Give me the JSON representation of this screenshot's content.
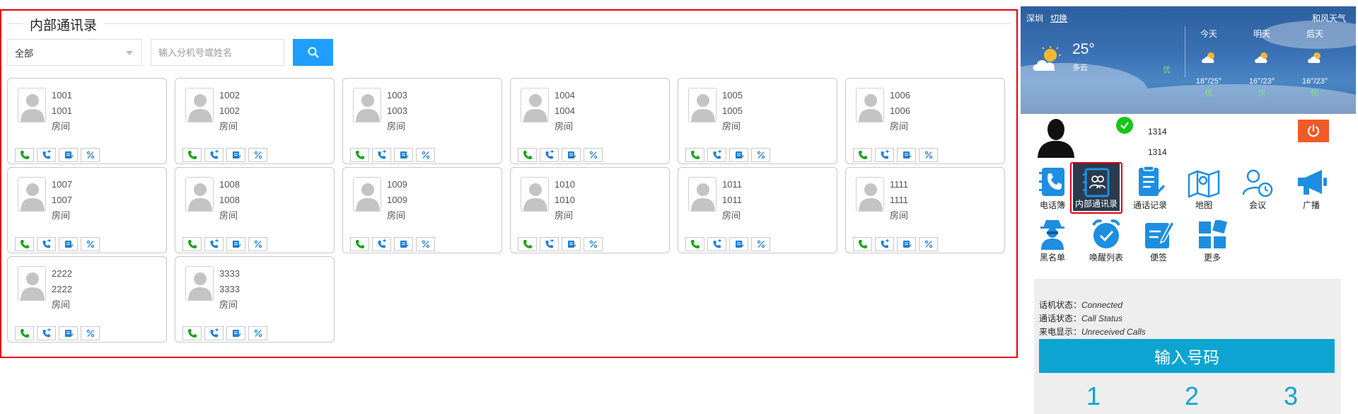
{
  "panel": {
    "title": "内部通讯录"
  },
  "filter": {
    "selected": "全部",
    "search_placeholder": "输入分机号或姓名"
  },
  "contacts": [
    {
      "number": "1001",
      "name": "1001",
      "room": "房间"
    },
    {
      "number": "1002",
      "name": "1002",
      "room": "房间"
    },
    {
      "number": "1003",
      "name": "1003",
      "room": "房间"
    },
    {
      "number": "1004",
      "name": "1004",
      "room": "房间"
    },
    {
      "number": "1005",
      "name": "1005",
      "room": "房间"
    },
    {
      "number": "1006",
      "name": "1006",
      "room": "房间"
    },
    {
      "number": "1007",
      "name": "1007",
      "room": "房间"
    },
    {
      "number": "1008",
      "name": "1008",
      "room": "房间"
    },
    {
      "number": "1009",
      "name": "1009",
      "room": "房间"
    },
    {
      "number": "1010",
      "name": "1010",
      "room": "房间"
    },
    {
      "number": "1011",
      "name": "1011",
      "room": "房间"
    },
    {
      "number": "1111",
      "name": "1111",
      "room": "房间"
    },
    {
      "number": "2222",
      "name": "2222",
      "room": "房间"
    },
    {
      "number": "3333",
      "name": "3333",
      "room": "房间"
    }
  ],
  "weather": {
    "city": "深圳",
    "switch": "切换",
    "temp": "25°",
    "desc": "多云",
    "aqi": "优",
    "brand": "和风天气",
    "days": [
      {
        "label": "今天",
        "range": "18°/25°",
        "quality": "优"
      },
      {
        "label": "明天",
        "range": "16°/23°",
        "quality": "优"
      },
      {
        "label": "后天",
        "range": "16°/23°",
        "quality": "优"
      }
    ]
  },
  "user": {
    "ext_line1": "1314",
    "ext_line2": "1314"
  },
  "menu": [
    {
      "label": "电话簿",
      "icon": "phonebook-icon"
    },
    {
      "label": "内部通讯录",
      "icon": "contacts-book-icon"
    },
    {
      "label": "通话记录",
      "icon": "call-log-icon"
    },
    {
      "label": "地图",
      "icon": "map-icon"
    },
    {
      "label": "会议",
      "icon": "meeting-icon"
    },
    {
      "label": "广播",
      "icon": "broadcast-icon"
    },
    {
      "label": "黑名单",
      "icon": "blacklist-icon"
    },
    {
      "label": "唤醒列表",
      "icon": "alarm-clock-icon"
    },
    {
      "label": "便签",
      "icon": "note-icon"
    },
    {
      "label": "更多",
      "icon": "more-icon"
    }
  ],
  "status": {
    "phone_label": "话机状态：",
    "phone_value": "Connected",
    "call_label": "通话状态：",
    "call_value": "Call Status",
    "incoming_label": "来电显示：",
    "incoming_value": "Unreceived Calls",
    "dial_placeholder": "输入号码"
  },
  "keypad": [
    "1",
    "2",
    "3"
  ],
  "colors": {
    "accent": "#1e9fff",
    "highlight_border": "#e60012",
    "dial": "#0ea4d2",
    "power": "#f05a28",
    "online": "#17c517"
  }
}
